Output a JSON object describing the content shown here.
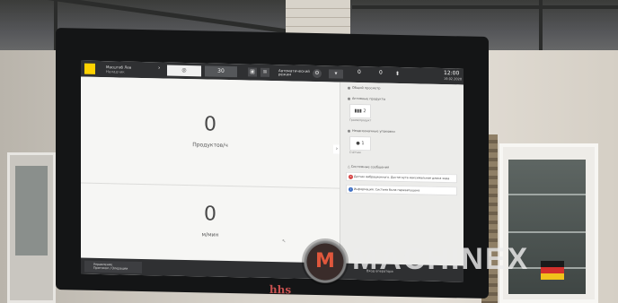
{
  "colors": {
    "header_bg": "#2f3032",
    "logo_yellow": "#ffd200",
    "panel_bg": "#f6f6f4",
    "brand_red": "#c6504f",
    "error_red": "#d64040",
    "info_blue": "#3e6fc4",
    "watermark_orange": "#e0573c"
  },
  "header": {
    "user_line1": "Масштаб Лев",
    "user_line2": "Наладчик",
    "tab_value": "30",
    "status_text": "Автоматический режим",
    "counter_left": "0",
    "counter_right": "0",
    "time": "12:00",
    "date": "19.02.2020",
    "icons": [
      "menu-icon",
      "camera-icon",
      "doc-icon",
      "settings-icon",
      "wrench-icon",
      "layers-icon"
    ]
  },
  "main": {
    "top_value": "0",
    "top_unit": "Продуктов/ч",
    "bottom_value": "0",
    "bottom_unit": "м/мин"
  },
  "side": {
    "section_general": "Общий просмотр",
    "section_products": "Активные продукты",
    "product_value": "2",
    "product_caption": "Грамм/продукт",
    "section_components": "Неоднозначные упаковки",
    "component_value": "1",
    "component_caption": "Счётчик",
    "section_messages": "Системные сообщения",
    "messages": [
      {
        "type": "error",
        "text": "Датчик вибрационного. Достигнута максимальная длина хода"
      },
      {
        "type": "info",
        "text": "Информация: Система была перезапущена"
      }
    ]
  },
  "footer": {
    "button_line1": "Управление",
    "button_line2": "Протокол / Операции",
    "right_text": "Вход оператора"
  },
  "brand": "hhs",
  "watermark": {
    "logo_letter": "M",
    "text": "MACHINEX"
  }
}
